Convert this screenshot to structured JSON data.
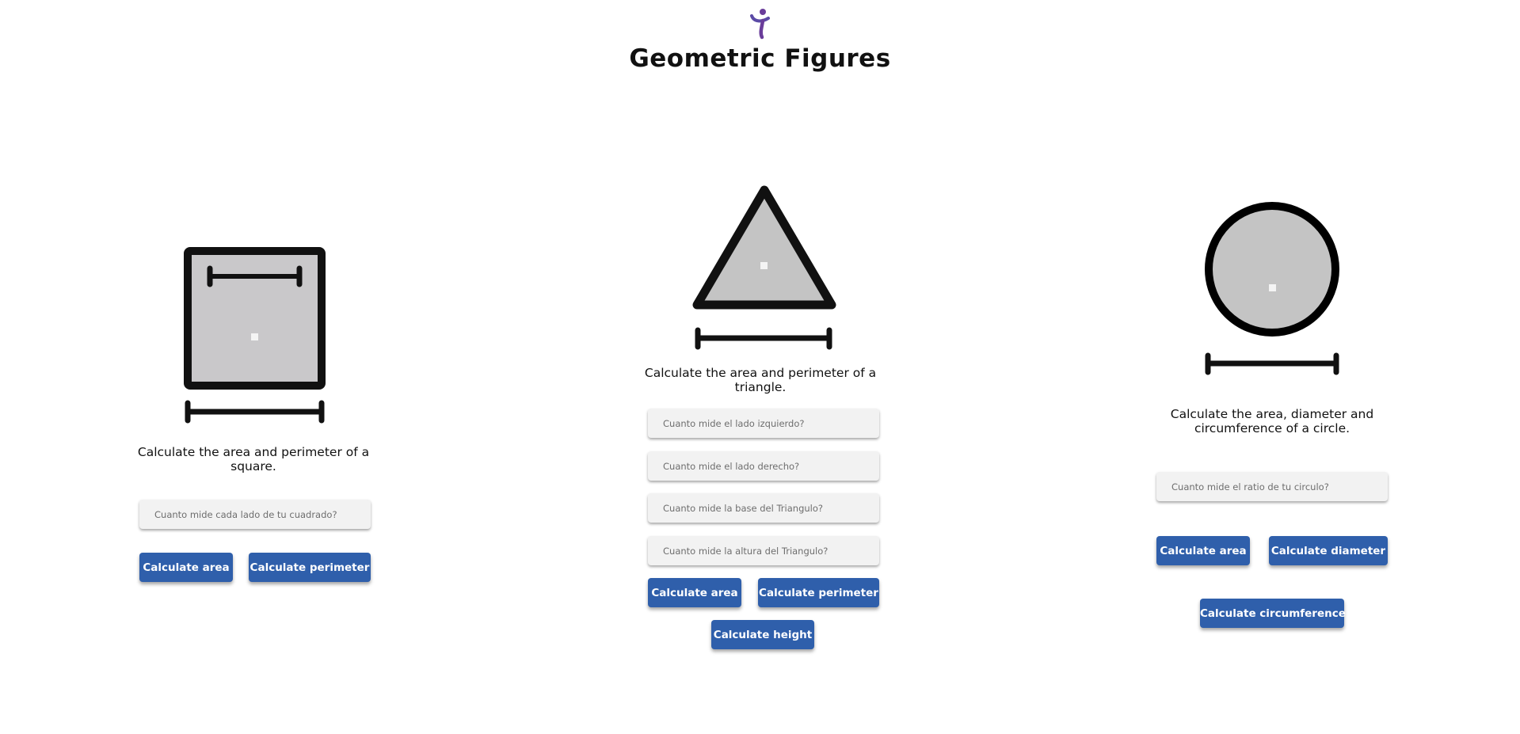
{
  "page": {
    "title": "Geometric Figures"
  },
  "square": {
    "description": "Calculate the area and perimeter of a square.",
    "side_input": {
      "placeholder": "Cuanto mide cada lado de tu cuadrado?",
      "value": ""
    },
    "area_button": "Calculate area",
    "perimeter_button": "Calculate perimeter"
  },
  "triangle": {
    "description": "Calculate the area and perimeter of a triangle.",
    "left_input": {
      "placeholder": "Cuanto mide el lado izquierdo?",
      "value": ""
    },
    "right_input": {
      "placeholder": "Cuanto mide el lado derecho?",
      "value": ""
    },
    "base_input": {
      "placeholder": "Cuanto mide la base del Triangulo?",
      "value": ""
    },
    "height_input": {
      "placeholder": "Cuanto mide la altura del Triangulo?",
      "value": ""
    },
    "area_button": "Calculate area",
    "perimeter_button": "Calculate perimeter",
    "height_button": "Calculate height"
  },
  "circle": {
    "description": "Calculate the area, diameter and circumference of a circle.",
    "radius_input": {
      "placeholder": "Cuanto mide el ratio de tu circulo?",
      "value": ""
    },
    "area_button": "Calculate area",
    "diameter_button": "Calculate diameter",
    "circumference_button": "Calculate circumference"
  },
  "colors": {
    "button": "#2f5fab",
    "shape_fill": "#c6c6c6",
    "shape_stroke": "#111111",
    "logo_purple": "#6a3d9a",
    "logo_blue": "#3a5fb0"
  },
  "icons": [
    "logo-icon",
    "square-figure-icon",
    "triangle-figure-icon",
    "circle-figure-icon",
    "measure-bar-icon"
  ]
}
